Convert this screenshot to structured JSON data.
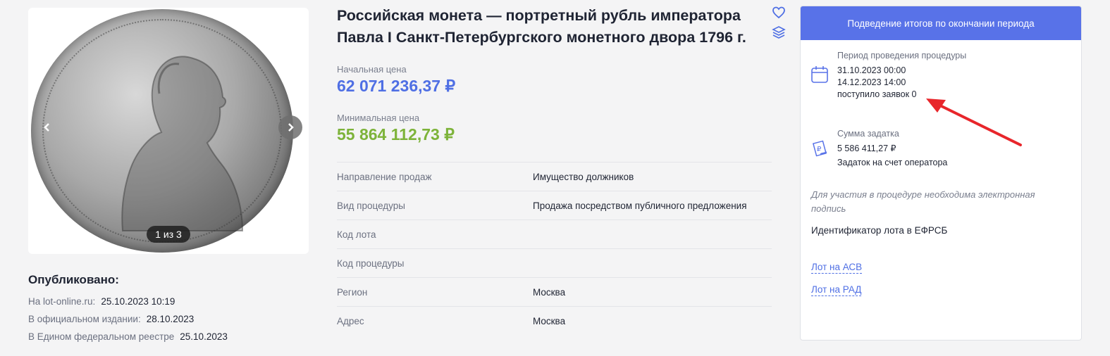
{
  "gallery": {
    "counter": "1 из 3"
  },
  "published": {
    "title": "Опубликовано:",
    "rows": [
      {
        "label": "На lot-online.ru:",
        "value": "25.10.2023 10:19"
      },
      {
        "label": "В официальном издании:",
        "value": "28.10.2023"
      },
      {
        "label": "В Едином федеральном реестре",
        "value": "25.10.2023"
      }
    ]
  },
  "lot": {
    "title": "Российская монета — портретный рубль императора Павла I Санкт-Петербургского монетного двора 1796 г.",
    "start_price_label": "Начальная цена",
    "start_price": "62 071 236,37  ₽",
    "min_price_label": "Минимальная цена",
    "min_price": "55 864 112,73  ₽",
    "info": [
      {
        "key": "Направление продаж",
        "value": "Имущество должников"
      },
      {
        "key": "Вид процедуры",
        "value": "Продажа посредством публичного предложения"
      },
      {
        "key": "Код лота",
        "value": ""
      },
      {
        "key": "Код процедуры",
        "value": ""
      },
      {
        "key": "Регион",
        "value": "Москва"
      },
      {
        "key": "Адрес",
        "value": "Москва"
      }
    ]
  },
  "icons": {
    "favorite": "heart-icon",
    "layers": "layers-icon",
    "calendar": "calendar-icon",
    "deposit": "ruble-document-icon"
  },
  "panel": {
    "header": "Подведение итогов по окончании периода",
    "period_label": "Период проведения процедуры",
    "period_start": "31.10.2023 00:00",
    "period_end": "14.12.2023 14:00",
    "applications": "поступило заявок 0",
    "deposit_label": "Сумма задатка",
    "deposit_value": "5 586 411,27 ₽",
    "deposit_note": "Задаток на счет оператора",
    "signature_note": "Для участия в процедуре необходима электронная подпись",
    "efrsb": "Идентификатор лота в ЕФРСБ",
    "link_asv": "Лот на АСВ",
    "link_rad": "Лот на РАД"
  },
  "colors": {
    "accent": "#5872e8",
    "start_price": "#4f6fe4",
    "min_price": "#7db33a",
    "annotation": "#e8262b"
  }
}
